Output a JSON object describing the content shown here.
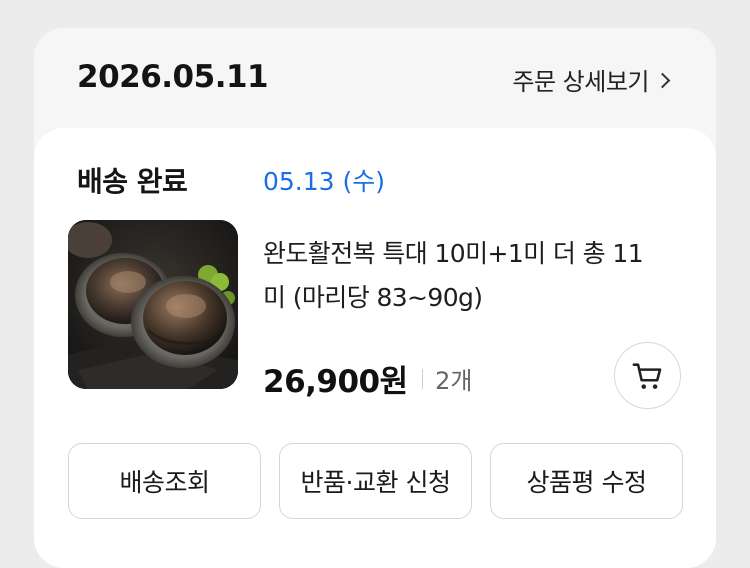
{
  "order": {
    "date": "2026.05.11",
    "detail_link": "주문 상세보기"
  },
  "shipment": {
    "status": "배송 완료",
    "arrival_date": "05.13 (수)"
  },
  "product": {
    "name_line1": "완도활전복 특대 10미+1미 더 총 11",
    "name_line2": "미 (마리당 83~90g)",
    "price": "26,900원",
    "quantity": "2개",
    "image": "abalone-photo"
  },
  "actions": {
    "track": "배송조회",
    "return_exchange": "반품·교환 신청",
    "edit_review": "상품평 수정"
  },
  "colors": {
    "accent_blue": "#1a6fe6",
    "background": "#ececec",
    "card": "#f6f6f6"
  }
}
